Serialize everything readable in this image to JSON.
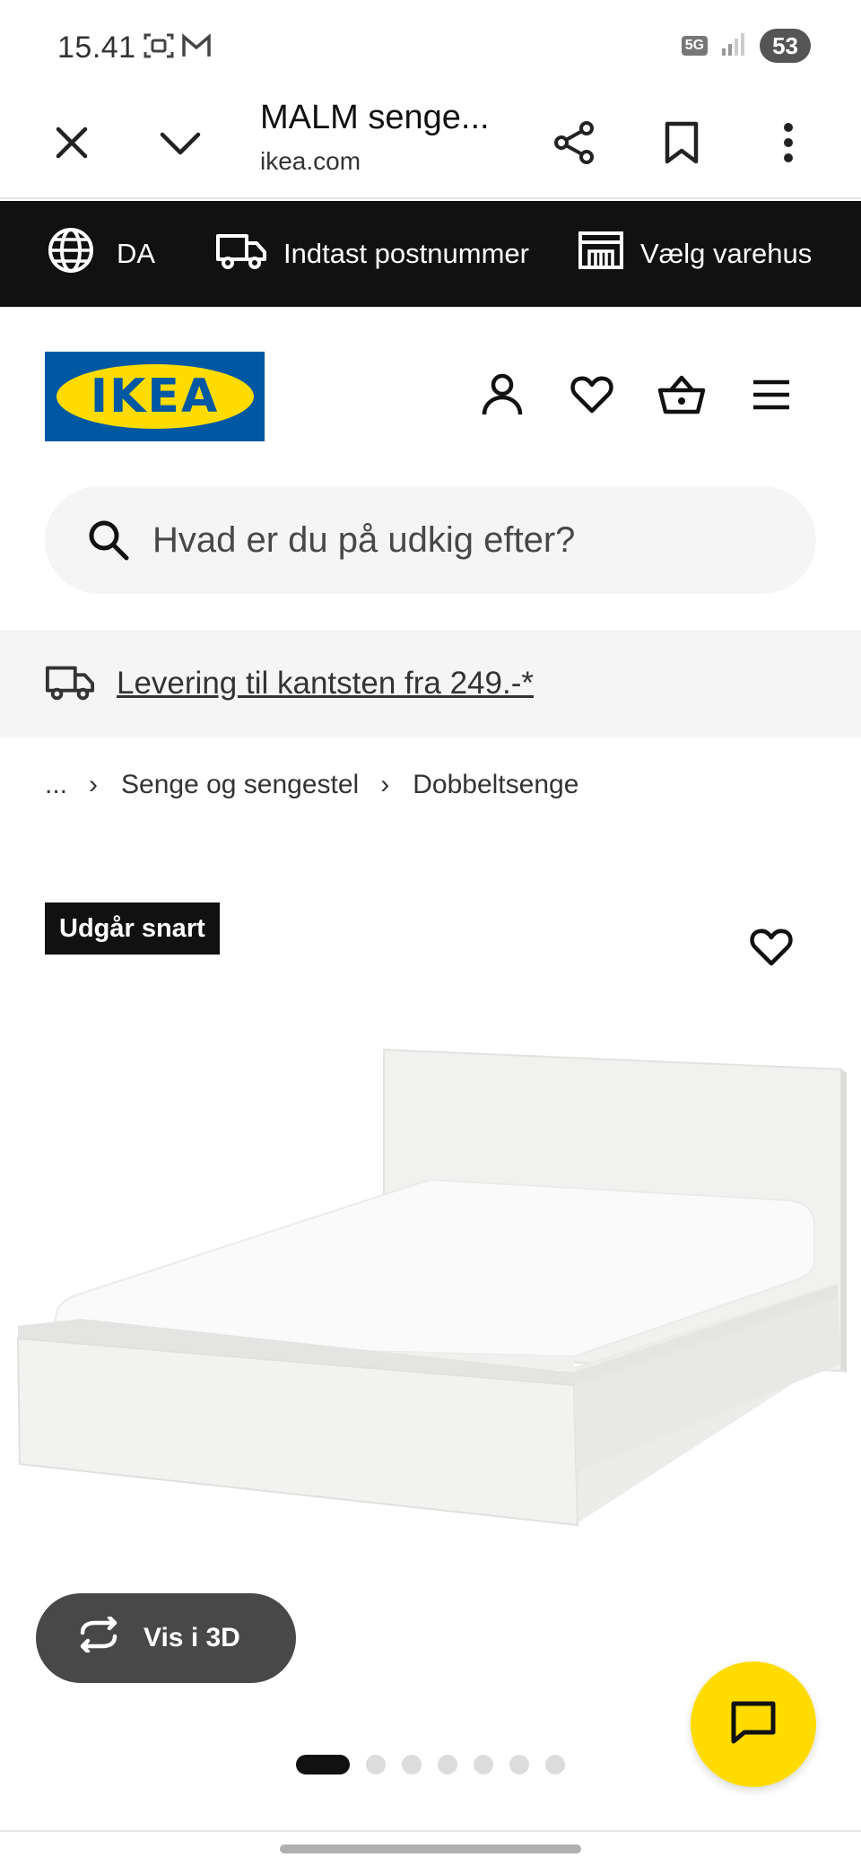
{
  "status_bar": {
    "time": "15.41",
    "network": "5G",
    "battery": "53"
  },
  "browser": {
    "title": "MALM senge...",
    "url": "ikea.com"
  },
  "utility": {
    "language": "DA",
    "postcode": "Indtast postnummer",
    "store": "Vælg varehus"
  },
  "brand": {
    "logo_text": "IKEA",
    "blue": "#0058a3",
    "yellow": "#ffdb00"
  },
  "search": {
    "placeholder": "Hvad er du på udkig efter?"
  },
  "delivery": {
    "text": "Levering til kantsten fra 249.-*"
  },
  "breadcrumb": {
    "ellipsis": "...",
    "items": [
      "Senge og sengestel",
      "Dobbeltsenge"
    ]
  },
  "product": {
    "badge": "Udgår snart"
  },
  "view3d": {
    "label": "Vis i 3D"
  },
  "carousel": {
    "count": 7,
    "active": 1
  },
  "icons": {
    "close": "close-icon",
    "chevron": "chevron-down-icon",
    "share": "share-icon",
    "bookmark": "bookmark-icon",
    "menu": "more-vert-icon",
    "globe": "globe-icon",
    "truck": "truck-icon",
    "store": "store-icon",
    "account": "account-icon",
    "favorites": "heart-icon",
    "basket": "basket-icon",
    "hamburger": "hamburger-icon",
    "search": "search-icon",
    "rotate": "rotate-3d-icon",
    "chat": "chat-icon"
  }
}
